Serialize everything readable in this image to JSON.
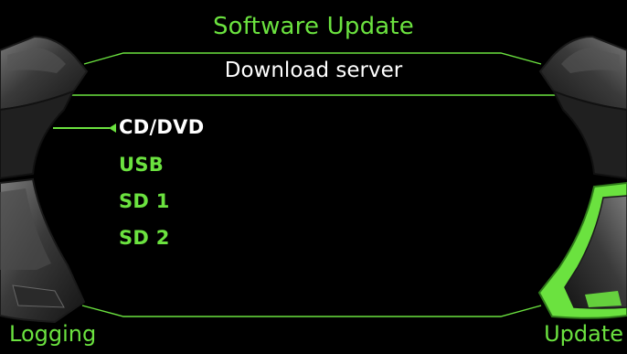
{
  "header": {
    "title": "Software Update",
    "subtitle": "Download server"
  },
  "menu": {
    "items": [
      {
        "label": "CD/DVD",
        "selected": true
      },
      {
        "label": "USB",
        "selected": false
      },
      {
        "label": "SD 1",
        "selected": false
      },
      {
        "label": "SD 2",
        "selected": false
      }
    ]
  },
  "softkeys": {
    "left_label": "Logging",
    "right_label": "Update"
  },
  "colors": {
    "accent": "#6be23f",
    "text": "#ffffff",
    "background": "#000000",
    "knob": "#3c3c3c"
  },
  "icons": {
    "selection_pointer": "left-pointing-triangle-icon",
    "rotary_controls": "rotary-knob-icon"
  }
}
